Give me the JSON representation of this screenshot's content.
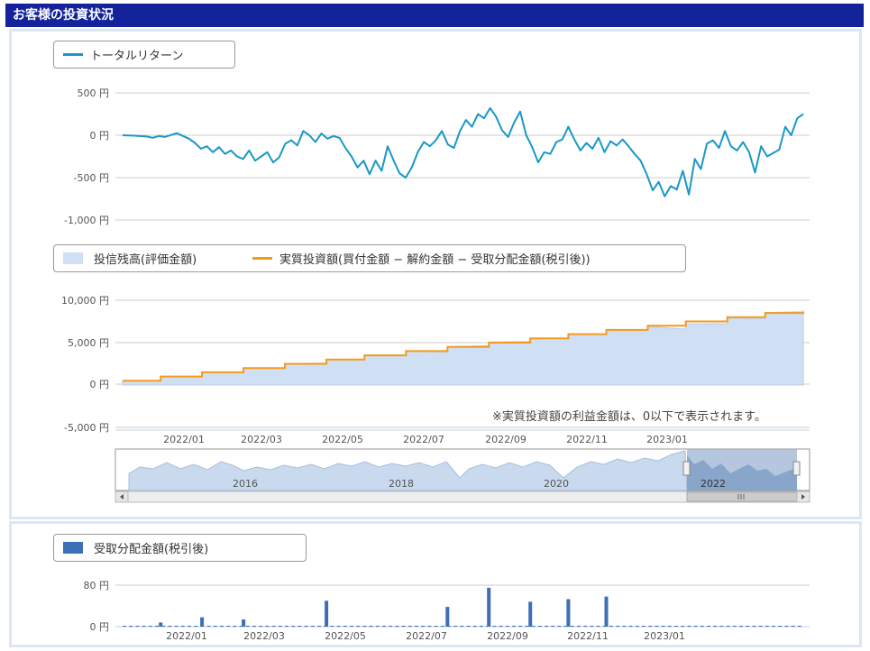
{
  "header": {
    "title": "お客様の投資状況"
  },
  "colors": {
    "header_bg": "#14239b",
    "total_return_line": "#1a98c5",
    "balance_fill": "#cfe0f5",
    "net_invest_line": "#f59a1d",
    "dividend_bar": "#3d6fb6",
    "navigator_fill": "#c9d9ee"
  },
  "chart_data": [
    {
      "type": "line",
      "legend": [
        "トータルリターン"
      ],
      "yticks": [
        "500 円",
        "0 円",
        "-500 円",
        "-1,000 円"
      ],
      "ylim": [
        -1000,
        500
      ],
      "series": [
        {
          "name": "トータルリターン",
          "points": [
            [
              0,
              0
            ],
            [
              4,
              -5
            ],
            [
              8,
              -15
            ],
            [
              10,
              -30
            ],
            [
              12,
              -10
            ],
            [
              14,
              -20
            ],
            [
              18,
              25
            ],
            [
              22,
              -40
            ],
            [
              24,
              -90
            ],
            [
              26,
              -160
            ],
            [
              28,
              -130
            ],
            [
              30,
              -200
            ],
            [
              32,
              -140
            ],
            [
              34,
              -220
            ],
            [
              36,
              -180
            ],
            [
              38,
              -250
            ],
            [
              40,
              -280
            ],
            [
              42,
              -180
            ],
            [
              44,
              -300
            ],
            [
              46,
              -250
            ],
            [
              48,
              -200
            ],
            [
              50,
              -320
            ],
            [
              52,
              -260
            ],
            [
              54,
              -100
            ],
            [
              56,
              -60
            ],
            [
              58,
              -120
            ],
            [
              60,
              50
            ],
            [
              62,
              0
            ],
            [
              64,
              -80
            ],
            [
              66,
              20
            ],
            [
              68,
              -40
            ],
            [
              70,
              -10
            ],
            [
              72,
              -30
            ],
            [
              74,
              -150
            ],
            [
              76,
              -250
            ],
            [
              78,
              -380
            ],
            [
              80,
              -300
            ],
            [
              82,
              -460
            ],
            [
              84,
              -300
            ],
            [
              86,
              -420
            ],
            [
              88,
              -130
            ],
            [
              90,
              -300
            ],
            [
              92,
              -450
            ],
            [
              94,
              -500
            ],
            [
              96,
              -380
            ],
            [
              98,
              -200
            ],
            [
              100,
              -80
            ],
            [
              102,
              -130
            ],
            [
              104,
              -60
            ],
            [
              106,
              50
            ],
            [
              108,
              -110
            ],
            [
              110,
              -150
            ],
            [
              112,
              50
            ],
            [
              114,
              180
            ],
            [
              116,
              100
            ],
            [
              118,
              250
            ],
            [
              120,
              200
            ],
            [
              122,
              320
            ],
            [
              124,
              220
            ],
            [
              126,
              60
            ],
            [
              128,
              -20
            ],
            [
              130,
              150
            ],
            [
              132,
              280
            ],
            [
              134,
              0
            ],
            [
              136,
              -140
            ],
            [
              138,
              -320
            ],
            [
              140,
              -200
            ],
            [
              142,
              -220
            ],
            [
              144,
              -80
            ],
            [
              146,
              -50
            ],
            [
              148,
              100
            ],
            [
              150,
              -50
            ],
            [
              152,
              -180
            ],
            [
              154,
              -90
            ],
            [
              156,
              -160
            ],
            [
              158,
              -30
            ],
            [
              160,
              -200
            ],
            [
              162,
              -70
            ],
            [
              164,
              -120
            ],
            [
              166,
              -50
            ],
            [
              168,
              -130
            ],
            [
              170,
              -220
            ],
            [
              172,
              -300
            ],
            [
              174,
              -460
            ],
            [
              176,
              -650
            ],
            [
              178,
              -550
            ],
            [
              180,
              -720
            ],
            [
              182,
              -600
            ],
            [
              184,
              -640
            ],
            [
              186,
              -420
            ],
            [
              188,
              -700
            ],
            [
              190,
              -280
            ],
            [
              192,
              -400
            ],
            [
              194,
              -100
            ],
            [
              196,
              -60
            ],
            [
              198,
              -150
            ],
            [
              200,
              50
            ],
            [
              202,
              -130
            ],
            [
              204,
              -180
            ],
            [
              206,
              -80
            ],
            [
              208,
              -200
            ],
            [
              210,
              -440
            ],
            [
              212,
              -130
            ],
            [
              214,
              -250
            ],
            [
              216,
              -210
            ],
            [
              218,
              -170
            ],
            [
              220,
              100
            ],
            [
              222,
              0
            ],
            [
              224,
              200
            ],
            [
              226,
              250
            ]
          ]
        }
      ]
    },
    {
      "type": "area",
      "legend": [
        "投信残高(評価金額)",
        "実質投資額(買付金額 − 解約金額 − 受取分配金額(税引後))"
      ],
      "yticks": [
        "10,000 円",
        "5,000 円",
        "0 円",
        "-5,000 円"
      ],
      "ylim": [
        -5000,
        10000
      ],
      "xticks": [
        "2022/01",
        "2022/03",
        "2022/05",
        "2022/07",
        "2022/09",
        "2022/11",
        "2023/01"
      ],
      "series": [
        {
          "name": "投信残高(評価金額)",
          "points": [
            [
              0,
              500
            ],
            [
              22,
              520
            ],
            [
              22,
              1020
            ],
            [
              46,
              1000
            ],
            [
              46,
              1520
            ],
            [
              70,
              1480
            ],
            [
              70,
              2020
            ],
            [
              94,
              1950
            ],
            [
              94,
              2520
            ],
            [
              118,
              2600
            ],
            [
              118,
              3000
            ],
            [
              140,
              3050
            ],
            [
              140,
              3500
            ],
            [
              164,
              3480
            ],
            [
              164,
              4050
            ],
            [
              188,
              3900
            ],
            [
              188,
              4520
            ],
            [
              212,
              4650
            ],
            [
              212,
              5050
            ],
            [
              236,
              5150
            ],
            [
              236,
              5500
            ],
            [
              258,
              5450
            ],
            [
              258,
              6050
            ],
            [
              280,
              5950
            ],
            [
              280,
              6550
            ],
            [
              304,
              6500
            ],
            [
              304,
              6900
            ],
            [
              326,
              6600
            ],
            [
              326,
              7200
            ],
            [
              350,
              7250
            ],
            [
              350,
              7900
            ],
            [
              372,
              7850
            ],
            [
              372,
              8550
            ],
            [
              394,
              8650
            ],
            [
              394,
              8800
            ]
          ]
        },
        {
          "name": "実質投資額(買付金額 − 解約金額 − 受取分配金額(税引後))",
          "points": [
            [
              0,
              500
            ],
            [
              22,
              500
            ],
            [
              22,
              1000
            ],
            [
              46,
              1000
            ],
            [
              46,
              1500
            ],
            [
              70,
              1500
            ],
            [
              70,
              2000
            ],
            [
              94,
              2000
            ],
            [
              94,
              2500
            ],
            [
              118,
              2500
            ],
            [
              118,
              3000
            ],
            [
              140,
              3000
            ],
            [
              140,
              3500
            ],
            [
              164,
              3500
            ],
            [
              164,
              4000
            ],
            [
              188,
              4000
            ],
            [
              188,
              4500
            ],
            [
              212,
              4500
            ],
            [
              212,
              5000
            ],
            [
              236,
              5000
            ],
            [
              236,
              5500
            ],
            [
              258,
              5500
            ],
            [
              258,
              6000
            ],
            [
              280,
              6000
            ],
            [
              280,
              6500
            ],
            [
              304,
              6500
            ],
            [
              304,
              7000
            ],
            [
              326,
              7000
            ],
            [
              326,
              7500
            ],
            [
              350,
              7500
            ],
            [
              350,
              8000
            ],
            [
              372,
              8000
            ],
            [
              372,
              8500
            ],
            [
              394,
              8500
            ],
            [
              394,
              8650
            ]
          ]
        }
      ],
      "note": "※実質投資額の利益金額は、0以下で表示されます。",
      "navigator_labels": [
        "2016",
        "2018",
        "2020",
        "2022"
      ]
    },
    {
      "type": "bar",
      "legend": [
        "受取分配金額(税引後)"
      ],
      "yticks": [
        "80 円",
        "0 円"
      ],
      "ylim": [
        0,
        80
      ],
      "xticks": [
        "2022/01",
        "2022/03",
        "2022/05",
        "2022/07",
        "2022/09",
        "2022/11",
        "2023/01"
      ],
      "series": [
        {
          "name": "受取分配金額(税引後)",
          "bars": [
            [
              22,
              8
            ],
            [
              46,
              18
            ],
            [
              70,
              14
            ],
            [
              118,
              50
            ],
            [
              188,
              38
            ],
            [
              212,
              75
            ],
            [
              236,
              48
            ],
            [
              258,
              53
            ],
            [
              280,
              58
            ]
          ]
        }
      ]
    }
  ]
}
